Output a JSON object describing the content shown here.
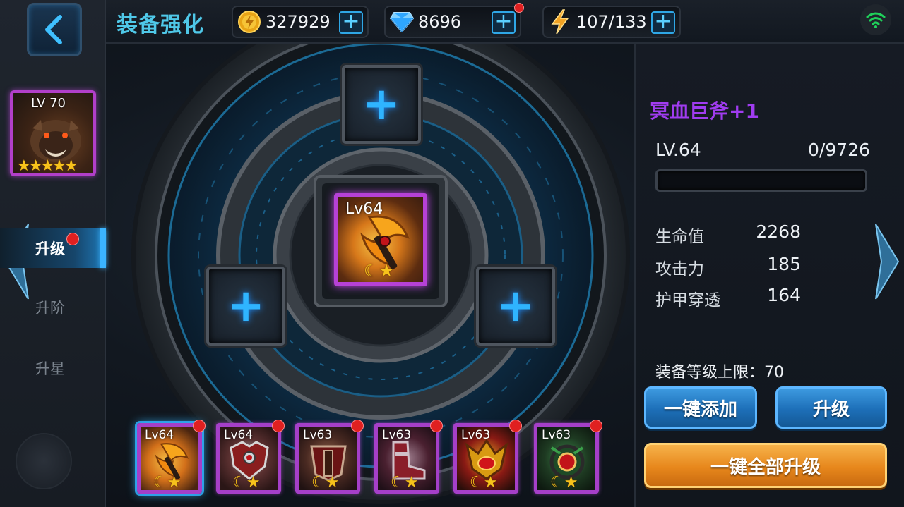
{
  "header": {
    "title": "装备强化",
    "back_icon": "back-arrow-icon"
  },
  "resources": {
    "gold": {
      "value": "327929",
      "icon": "gold-coin-icon"
    },
    "diamond": {
      "value": "8696",
      "icon": "diamond-icon",
      "has_notification": true
    },
    "energy": {
      "value": "107/133",
      "icon": "lightning-icon"
    }
  },
  "status": {
    "wifi_icon": "wifi-icon",
    "wifi_color": "#1fd15a"
  },
  "hero": {
    "level": "LV 70",
    "stars": "★★★★★"
  },
  "tabs": [
    {
      "label": "升级",
      "active": true,
      "has_notification": true
    },
    {
      "label": "升阶",
      "active": false
    },
    {
      "label": "升星",
      "active": false
    }
  ],
  "forge": {
    "main_item": {
      "level": "Lv64",
      "stars": "☾★"
    },
    "empty_slot_symbol": "+"
  },
  "inventory": [
    {
      "level": "Lv64",
      "stars": "☾★",
      "selected": true
    },
    {
      "level": "Lv64",
      "stars": "☾★",
      "selected": false
    },
    {
      "level": "Lv63",
      "stars": "☾★",
      "selected": false
    },
    {
      "level": "Lv63",
      "stars": "☾★",
      "selected": false
    },
    {
      "level": "Lv63",
      "stars": "☾★",
      "selected": false
    },
    {
      "level": "Lv63",
      "stars": "☾★",
      "selected": false
    }
  ],
  "detail": {
    "item_name": "冥血巨斧+1",
    "level": "LV.64",
    "exp": "0/9726",
    "exp_fraction": 0,
    "stats": [
      {
        "label": "生命值",
        "value": "2268"
      },
      {
        "label": "攻击力",
        "value": "185"
      },
      {
        "label": "护甲穿透",
        "value": "164"
      }
    ],
    "cap": "装备等级上限：70"
  },
  "buttons": {
    "auto_add": "一键添加",
    "upgrade": "升级",
    "upgrade_all": "一键全部升级"
  },
  "colors": {
    "accent_blue": "#2fb4ff",
    "rarity_purple": "#b641d6",
    "item_name": "#a03cf0",
    "title": "#4fc8e8",
    "gold_button": "#e7871c"
  }
}
